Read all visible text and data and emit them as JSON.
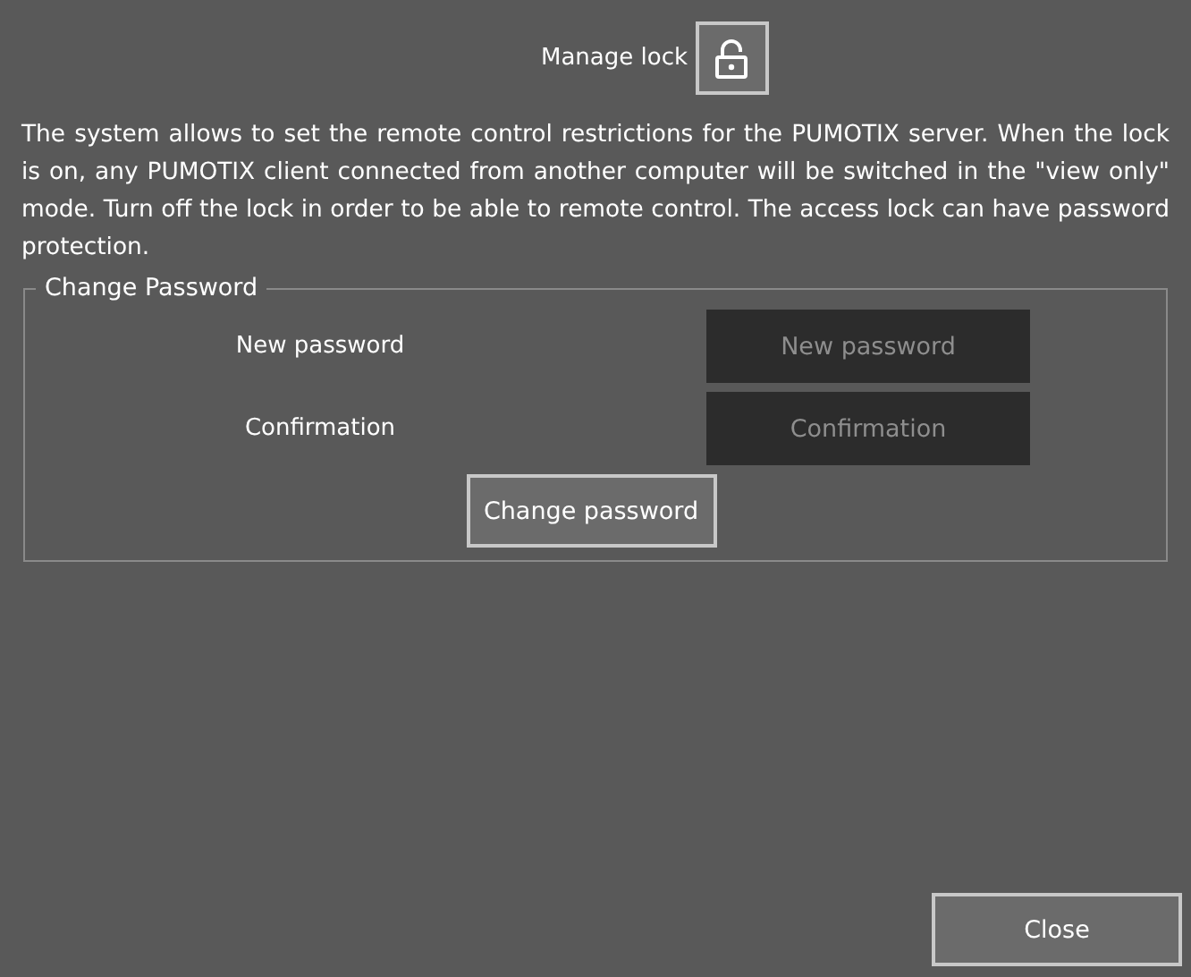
{
  "header": {
    "title": "Manage lock",
    "locked": false
  },
  "description": "The system allows to set the remote control restrictions for the PUMOTIX server. When the lock is on, any PUMOTIX client connected from another computer will be switched in the \"view only\" mode. Turn off the lock in order to be able to remote control. The access lock can have password protection.",
  "password_group": {
    "legend": "Change Password",
    "fields": [
      {
        "label": "New password",
        "placeholder": "New password"
      },
      {
        "label": "Confirmation",
        "placeholder": "Confirmation"
      }
    ],
    "button": "Change password"
  },
  "footer": {
    "close_button": "Close"
  }
}
